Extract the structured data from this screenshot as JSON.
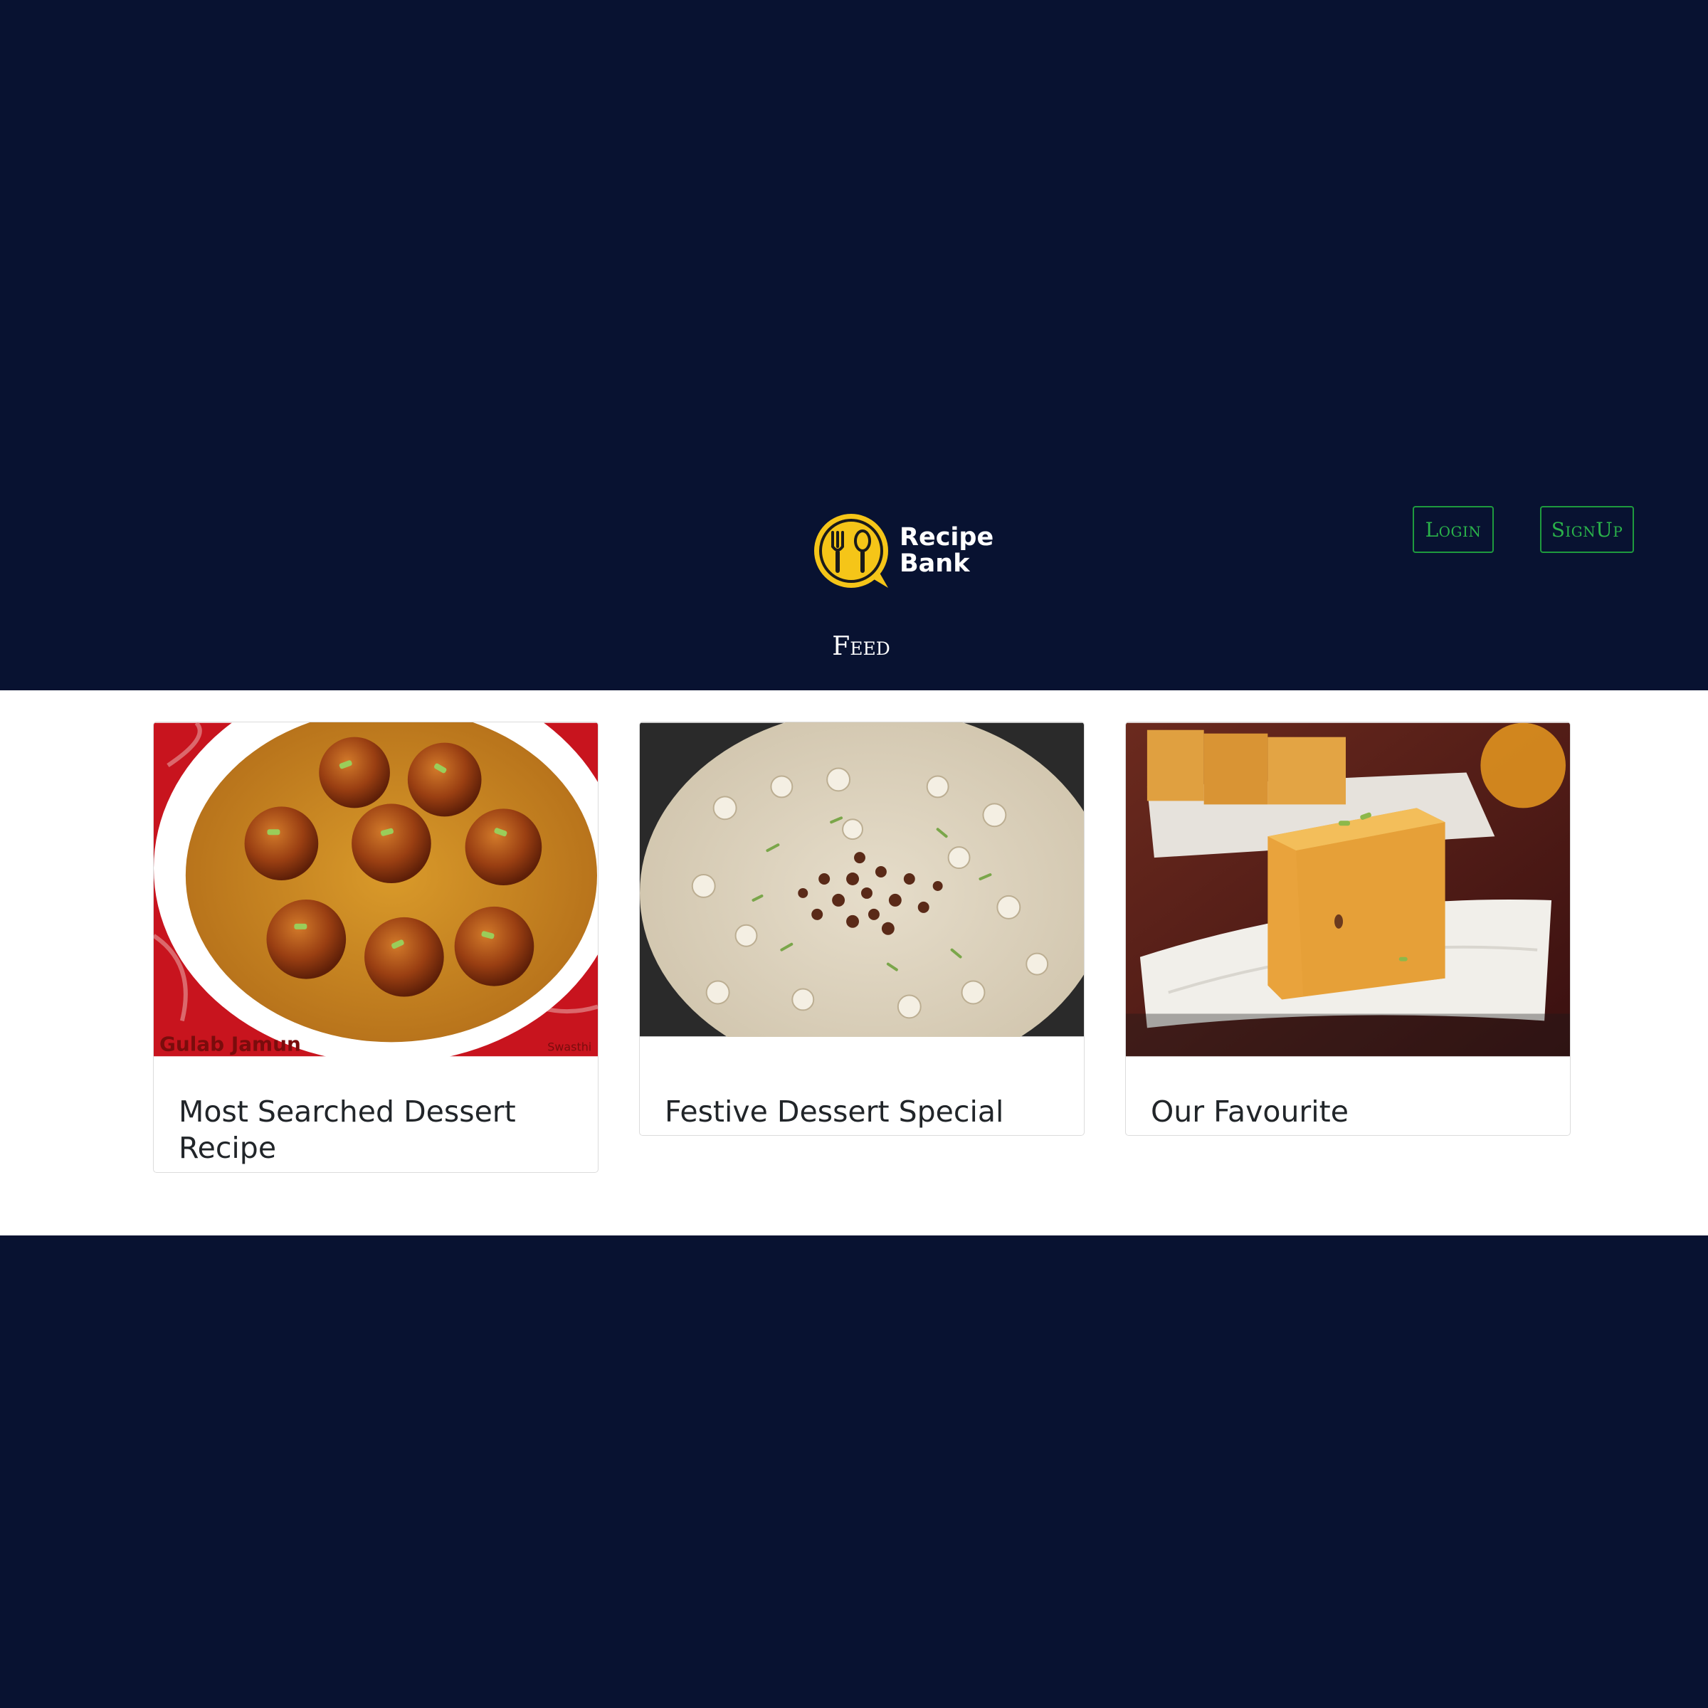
{
  "header": {
    "logo": {
      "line1": "Recipe",
      "line2": "Bank",
      "accent": "#f5c518"
    },
    "auth": {
      "login_label": "Login",
      "signup_label": "SignUp",
      "accent": "#2ab24a"
    },
    "nav": {
      "feed_label": "Feed"
    }
  },
  "colors": {
    "background": "#081231",
    "content": "#ffffff"
  },
  "cards": [
    {
      "title": "Most Searched Dessert Recipe",
      "image": "gulab-jamun-photo",
      "image_caption": "Gulab Jamun",
      "image_watermark": "Swasthi"
    },
    {
      "title": "Festive Dessert Special",
      "image": "makhana-kheer-photo"
    },
    {
      "title": "Our Favourite",
      "image": "mysore-pak-photo"
    }
  ]
}
